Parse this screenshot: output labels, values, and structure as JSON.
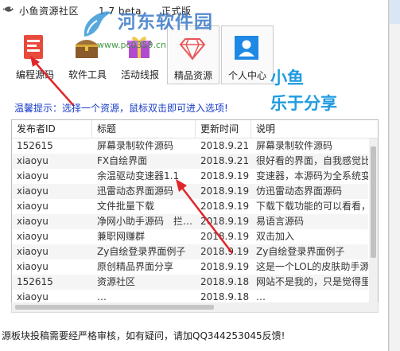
{
  "window": {
    "title": "小鱼资源社区　　1.7 beta　　正式版"
  },
  "watermark": {
    "name": "河东软件园",
    "url": "www.pc0359.cn"
  },
  "toolbar": {
    "items": [
      {
        "label": "编程源码",
        "icon": "code-box-icon"
      },
      {
        "label": "软件工具",
        "icon": "treasure-chest-icon"
      },
      {
        "label": "活动线报",
        "icon": "gift-icon"
      },
      {
        "label": "精品资源",
        "icon": "diamond-icon"
      },
      {
        "label": "个人中心",
        "icon": "user-icon"
      }
    ]
  },
  "slogan": {
    "line1": "小鱼",
    "line2": "乐于分享"
  },
  "hint": "温馨提示：选择一个资源，鼠标双击即可进入选项!",
  "table": {
    "columns": [
      "发布者ID",
      "标题",
      "更新时间",
      "说明"
    ],
    "rows": [
      [
        "152615",
        "屏幕录制软件源码",
        "2018.9.21",
        "屏幕录制软件源码"
      ],
      [
        "xiaoyu",
        "FX自绘界面",
        "2018.9.21",
        "很好看的界面，自我感觉比"
      ],
      [
        "xiaoyu",
        "余温驱动变速器1.1",
        "2018.9.19",
        "变速器，本源码为全系统变"
      ],
      [
        "xiaoyu",
        "迅雷动态界面源码",
        "2018.9.19",
        "仿迅雷动态界面源码"
      ],
      [
        "xiaoyu",
        "文件批量下载",
        "2018.9.19",
        "下载下载功能的可以看看，"
      ],
      [
        "xiaoyu",
        "净网小助手源码　拦…",
        "2018.9.19",
        "易语言源码"
      ],
      [
        "xiaoyu",
        "兼职网赚群",
        "2018.9.19",
        "双击加入"
      ],
      [
        "xiaoyu",
        "Zy自绘登录界面例子",
        "2018.9.19",
        "Zy自绘登录界面例子"
      ],
      [
        "xiaoyu",
        "原创精品界面分享",
        "2018.9.19",
        "这是一个LOL的皮肤助手源"
      ],
      [
        "152615",
        "资源社区",
        "2018.9.18",
        "网站不是我的，只是觉得里面"
      ],
      [
        "xiaoyu",
        "…",
        "2018.9.18",
        "…"
      ]
    ]
  },
  "status": "源板块投稿需要经严格审核，如有疑问，请加QQ344253045反馈!",
  "colors": {
    "hint": "#1a3ec8",
    "slogan": "#1f9be0",
    "arrow": "#e0262b",
    "watermark": "#3a7ac8"
  }
}
